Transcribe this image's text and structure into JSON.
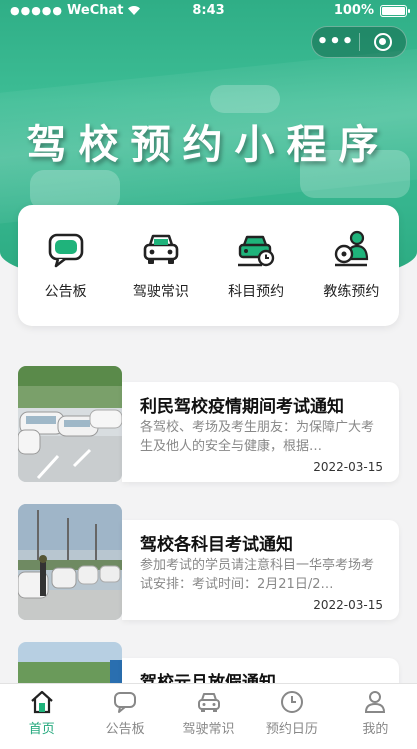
{
  "status_bar": {
    "signal": "●●●●●",
    "carrier": "WeChat",
    "time": "8:43",
    "battery": "100%"
  },
  "capsule": {
    "more": "•••"
  },
  "header": {
    "title": "驾校预约小程序"
  },
  "menu": [
    {
      "label": "公告板",
      "icon": "bulletin-icon"
    },
    {
      "label": "驾驶常识",
      "icon": "car-icon"
    },
    {
      "label": "科目预约",
      "icon": "car-clock-icon"
    },
    {
      "label": "教练预约",
      "icon": "coach-icon"
    }
  ],
  "news": [
    {
      "title": "利民驾校疫情期间考试通知",
      "desc": "各驾校、考场及考生朋友：为保障广大考生及他人的安全与健康，根据…",
      "date": "2022-03-15"
    },
    {
      "title": "驾校各科目考试通知",
      "desc": "参加考试的学员请注意科目一华亭考场考试安排：考试时间：2月21日/2…",
      "date": "2022-03-15"
    },
    {
      "title": "驾校元旦放假通知",
      "desc": "",
      "date": ""
    }
  ],
  "tabbar": [
    {
      "label": "首页",
      "icon": "home-icon",
      "active": true
    },
    {
      "label": "公告板",
      "icon": "chat-icon",
      "active": false
    },
    {
      "label": "驾驶常识",
      "icon": "car-icon",
      "active": false
    },
    {
      "label": "预约日历",
      "icon": "clock-icon",
      "active": false
    },
    {
      "label": "我的",
      "icon": "user-icon",
      "active": false
    }
  ],
  "colors": {
    "brand": "#2fae86",
    "active_tab": "#22a87c"
  }
}
